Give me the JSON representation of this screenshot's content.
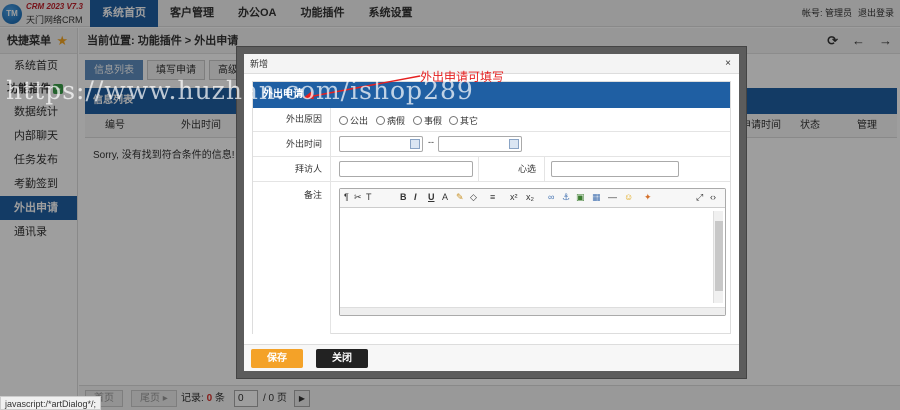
{
  "logo": {
    "version": "CRM 2023 V7.3",
    "name": "天门网络CRM",
    "mark": "TM"
  },
  "nav": [
    "系统首页",
    "客户管理",
    "办公OA",
    "功能插件",
    "系统设置"
  ],
  "account": {
    "user": "帐号: 管理员",
    "logout": "退出登录"
  },
  "sidebar": {
    "title": "快捷菜单",
    "home": "系统首页",
    "group": "功能插件",
    "items": [
      "数据统计",
      "内部聊天",
      "任务发布",
      "考勤签到",
      "外出申请",
      "通讯录"
    ]
  },
  "breadcrumb": "当前位置: 功能插件 > 外出申请",
  "tabs": [
    "信息列表",
    "填写申请",
    "高级管"
  ],
  "list": {
    "title": "信息列表",
    "columns": [
      "编号",
      "外出时间",
      "申请时间",
      "状态",
      "管理"
    ],
    "empty": "Sorry, 没有找到符合条件的信息!"
  },
  "pager": {
    "first": "首页",
    "last": "尾页",
    "records_label": "记录:",
    "records": "0",
    "unit": "条",
    "page": "0",
    "total": "/ 0 页"
  },
  "dialog": {
    "title": "新增",
    "header": "外出申请",
    "labels": {
      "reason": "外出原因",
      "time": "外出时间",
      "visitor": "拜访人",
      "remark": "心选",
      "note": "备注"
    },
    "reasons": [
      "公出",
      "病假",
      "事假",
      "其它"
    ],
    "dash": "--",
    "save": "保存",
    "close": "关闭",
    "close_icon": "×"
  },
  "annotation": "外出申请可填写",
  "watermark": "https://www.huzhan.com/ishop289",
  "status_bar": "javascript:/*artDialog*/;"
}
